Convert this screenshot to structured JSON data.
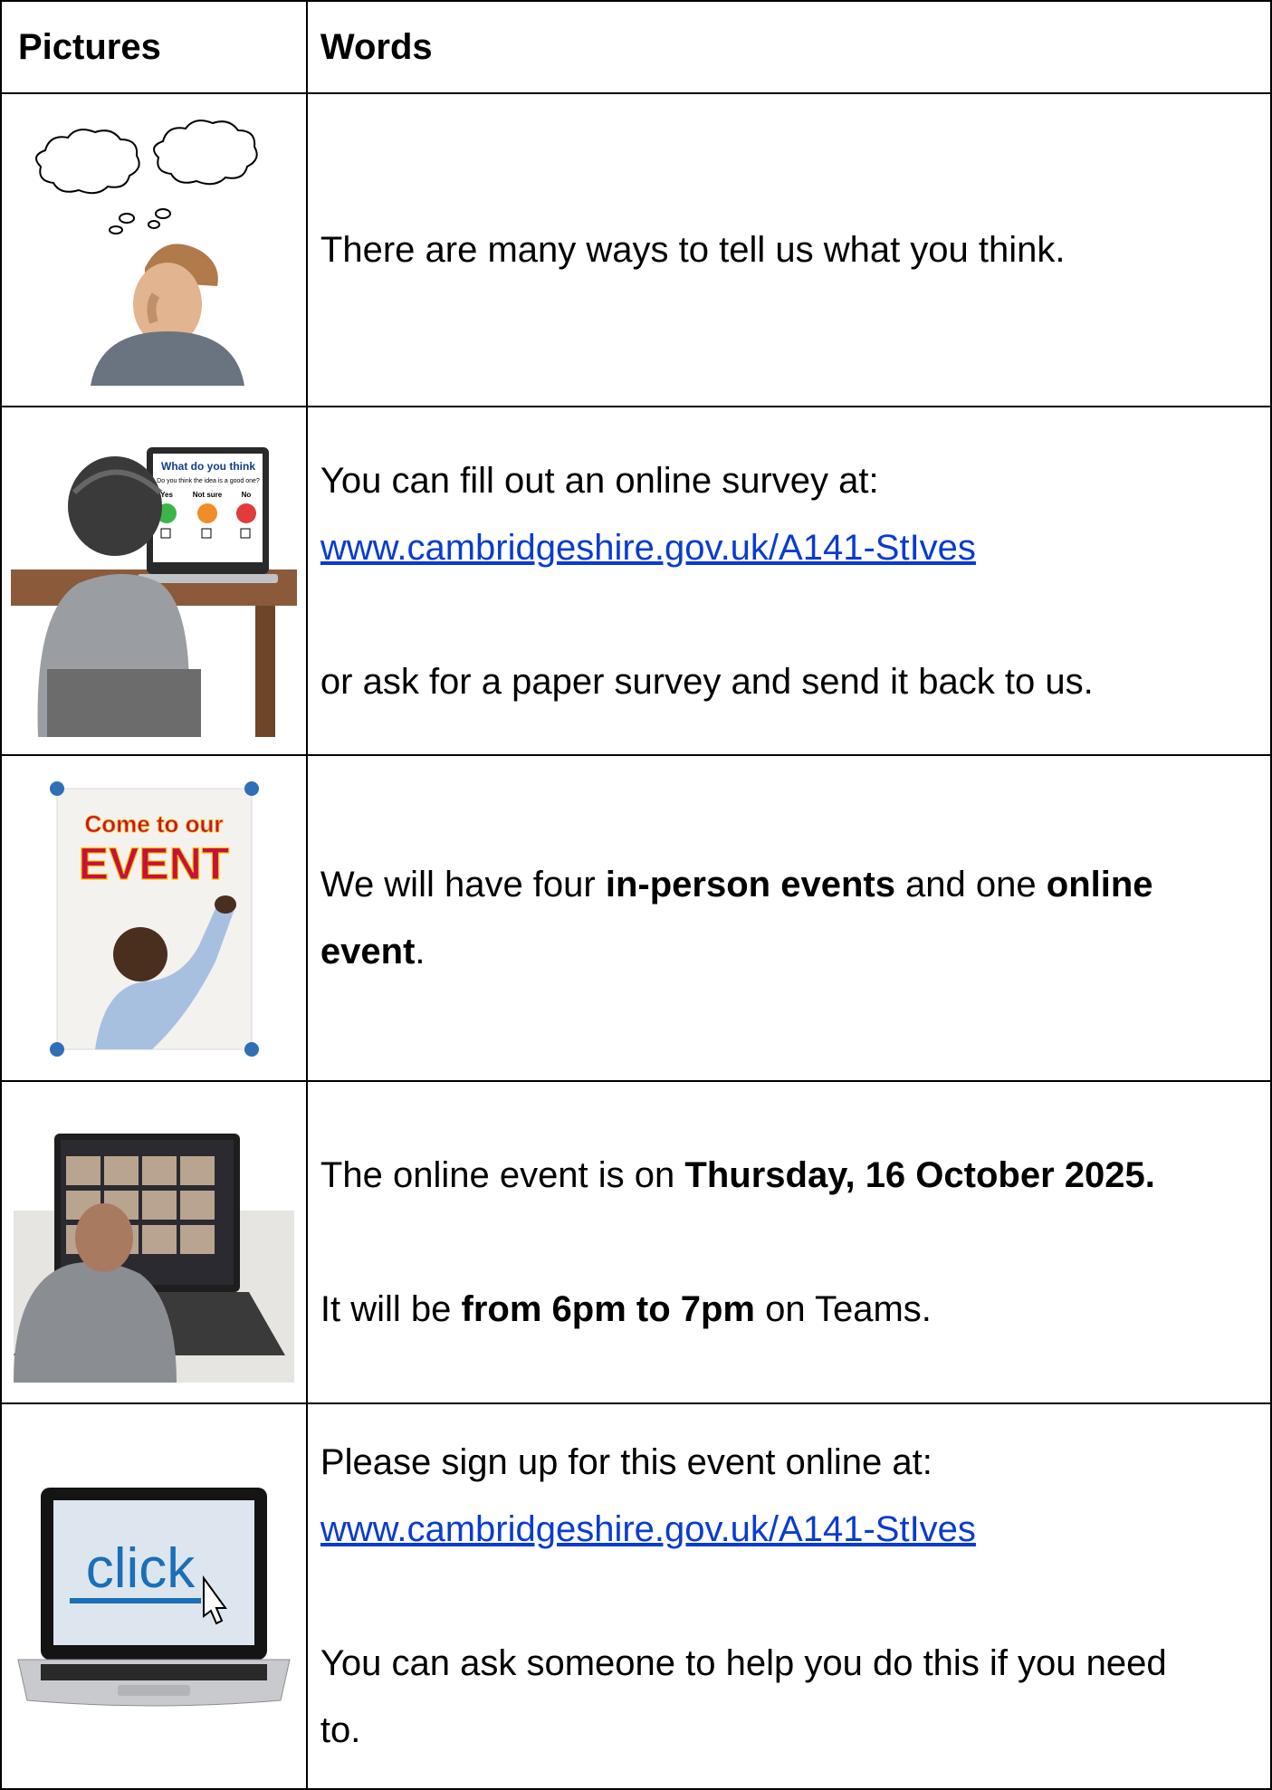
{
  "header": {
    "pictures": "Pictures",
    "words": "Words"
  },
  "rows": [
    {
      "text": "There are many ways to tell us what you think."
    },
    {
      "intro": "You can fill out an online survey at:",
      "link": "www.cambridgeshire.gov.uk/A141-StIves",
      "outro": "or ask for a paper survey and send it back to us.",
      "survey_title": "What do you think",
      "survey_question": "Do you think the idea is a good one?",
      "survey_yes": "Yes",
      "survey_notsure": "Not sure",
      "survey_no": "No"
    },
    {
      "t1": "We will have four ",
      "b1": "in-person events",
      "t2": " and one ",
      "b2": "online",
      "b3": "event",
      "t3": ".",
      "poster_line1": "Come to our",
      "poster_line2": "EVENT"
    },
    {
      "t1": "The online event is on ",
      "b1": "Thursday, 16 October 2025.",
      "t2": "It will be ",
      "b2": "from 6pm to 7pm",
      "t3": " on Teams."
    },
    {
      "intro": "Please sign up for this event online at:",
      "link": "www.cambridgeshire.gov.uk/A141-StIves",
      "outro1": "You can ask someone to help you do this if you need",
      "outro2": "to.",
      "screen_word": "click"
    }
  ],
  "colors": {
    "link": "#0a3ccf",
    "border": "#000000",
    "click_blue": "#1a6fb8"
  }
}
